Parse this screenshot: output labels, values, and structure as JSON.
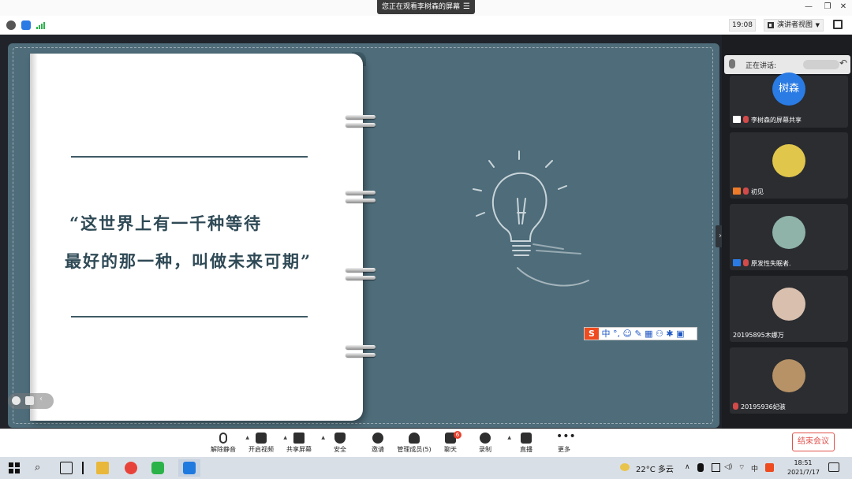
{
  "titlebar": {
    "share_banner": "您正在观看李树森的屏幕"
  },
  "toolbar": {
    "time": "19:08",
    "view_mode": "演讲者视图"
  },
  "slide": {
    "quote_line1": "“这世界上有一千种等待",
    "quote_line2": "最好的那一种，叫做未来可期”",
    "ime_text": "中 °, ☺ ✎ ▦ ⚇ ✱ ▣"
  },
  "panel": {
    "speaking_label": "正在讲话:",
    "tiles": [
      {
        "avatar_text": "树森",
        "label": "李树森的屏幕共享"
      },
      {
        "avatar_text": "",
        "label": "初见"
      },
      {
        "avatar_text": "",
        "label": "原发性失眠者."
      },
      {
        "avatar_text": "",
        "label": "20195895木娜万"
      },
      {
        "avatar_text": "",
        "label": "20195936妃骇"
      }
    ]
  },
  "controls": {
    "unmute": "解除静音",
    "start_video": "开启视频",
    "share_screen": "共享屏幕",
    "security": "安全",
    "invite": "邀请",
    "participants": "管理成员(5)",
    "chat": "聊天",
    "chat_badge": "6",
    "record": "录制",
    "live": "直播",
    "more": "更多",
    "end_meeting": "结束会议"
  },
  "taskbar": {
    "weather": "22°C 多云",
    "time": "18:51",
    "date": "2021/7/17"
  },
  "colors": {
    "slide_bg": "#4e6c7a",
    "accent_blue": "#2a7be4",
    "end_red": "#e0524b"
  }
}
